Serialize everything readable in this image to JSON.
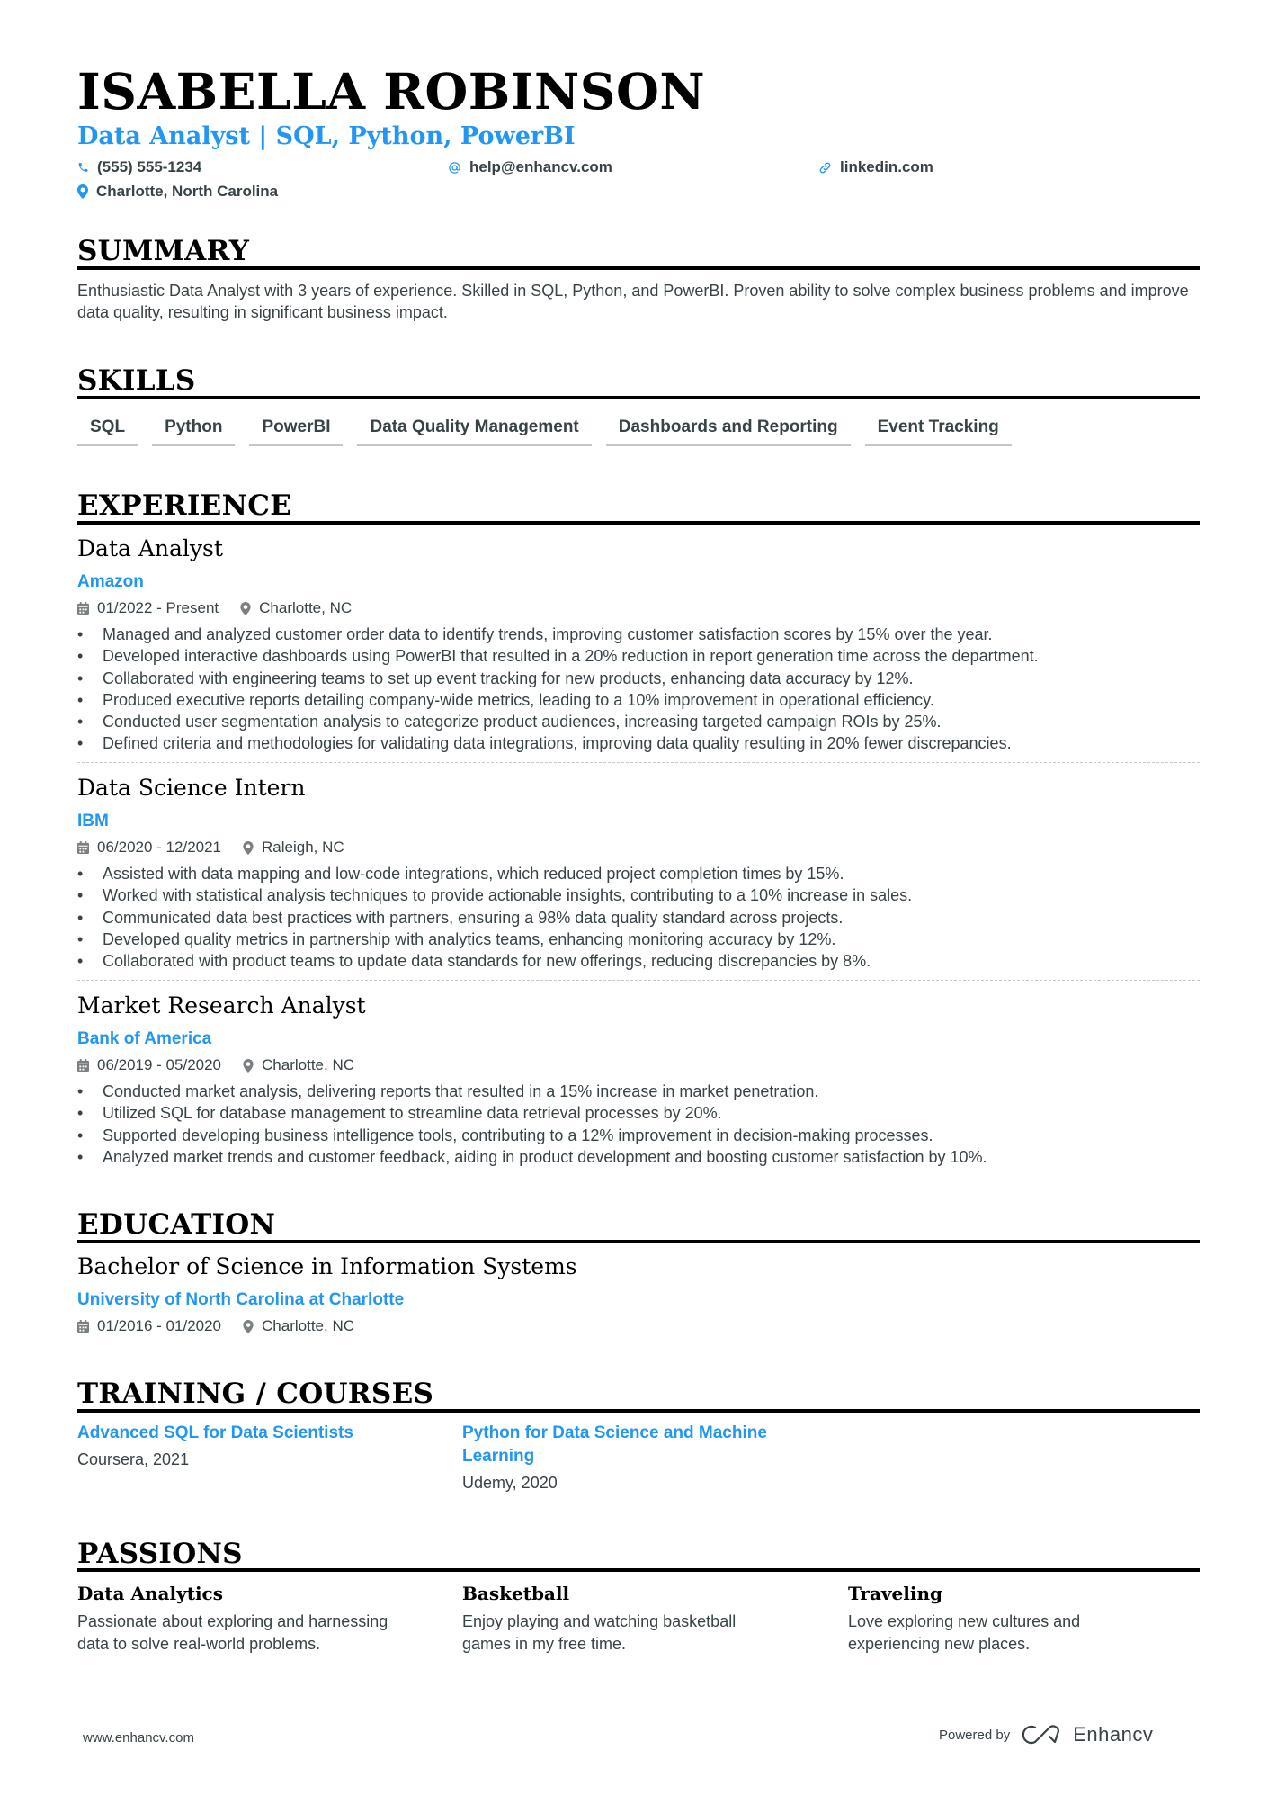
{
  "header": {
    "name": "ISABELLA ROBINSON",
    "subtitle": "Data Analyst | SQL, Python, PowerBI",
    "contacts": {
      "phone": {
        "icon": "phone-icon",
        "value": "(555) 555-1234"
      },
      "email": {
        "icon": "at-icon",
        "value": "help@enhancv.com"
      },
      "link": {
        "icon": "link-icon",
        "value": "linkedin.com"
      },
      "location": {
        "icon": "location-pin-icon",
        "value": "Charlotte, North Carolina"
      }
    }
  },
  "colors": {
    "accent": "#2196f3",
    "heading": "#000000",
    "text": "#384347",
    "skill_underline": "#c4c6c8"
  },
  "summary": {
    "title": "SUMMARY",
    "text": "Enthusiastic Data Analyst with 3 years of experience. Skilled in SQL, Python, and PowerBI. Proven ability to solve complex business problems and improve data quality, resulting in significant business impact."
  },
  "skills": {
    "title": "SKILLS",
    "items": [
      "SQL",
      "Python",
      "PowerBI",
      "Data Quality Management",
      "Dashboards and Reporting",
      "Event Tracking"
    ]
  },
  "experience": {
    "title": "EXPERIENCE",
    "jobs": [
      {
        "title": "Data Analyst",
        "company": "Amazon",
        "dates": "01/2022 - Present",
        "location": "Charlotte, NC",
        "bullets": [
          "Managed and analyzed customer order data to identify trends, improving customer satisfaction scores by 15% over the year.",
          "Developed interactive dashboards using PowerBI that resulted in a 20% reduction in report generation time across the department.",
          "Collaborated with engineering teams to set up event tracking for new products, enhancing data accuracy by 12%.",
          "Produced executive reports detailing company-wide metrics, leading to a 10% improvement in operational efficiency.",
          "Conducted user segmentation analysis to categorize product audiences, increasing targeted campaign ROIs by 25%.",
          "Defined criteria and methodologies for validating data integrations, improving data quality resulting in 20% fewer discrepancies."
        ]
      },
      {
        "title": "Data Science Intern",
        "company": "IBM",
        "dates": "06/2020 - 12/2021",
        "location": "Raleigh, NC",
        "bullets": [
          "Assisted with data mapping and low-code integrations, which reduced project completion times by 15%.",
          "Worked with statistical analysis techniques to provide actionable insights, contributing to a 10% increase in sales.",
          "Communicated data best practices with partners, ensuring a 98% data quality standard across projects.",
          "Developed quality metrics in partnership with analytics teams, enhancing monitoring accuracy by 12%.",
          "Collaborated with product teams to update data standards for new offerings, reducing discrepancies by 8%."
        ]
      },
      {
        "title": "Market Research Analyst",
        "company": "Bank of America",
        "dates": "06/2019 - 05/2020",
        "location": "Charlotte, NC",
        "bullets": [
          "Conducted market analysis, delivering reports that resulted in a 15% increase in market penetration.",
          "Utilized SQL for database management to streamline data retrieval processes by 20%.",
          "Supported developing business intelligence tools, contributing to a 12% improvement in decision-making processes.",
          "Analyzed market trends and customer feedback, aiding in product development and boosting customer satisfaction by 10%."
        ]
      }
    ]
  },
  "education": {
    "title": "EDUCATION",
    "degree": "Bachelor of Science in Information Systems",
    "school": "University of North Carolina at Charlotte",
    "dates": "01/2016 - 01/2020",
    "location": "Charlotte, NC"
  },
  "training": {
    "title": "TRAINING / COURSES",
    "items": [
      {
        "title": "Advanced SQL for Data Scientists",
        "provider": "Coursera, 2021"
      },
      {
        "title": "Python for Data Science and Machine Learning",
        "provider": "Udemy, 2020"
      }
    ]
  },
  "passions": {
    "title": "PASSIONS",
    "items": [
      {
        "title": "Data Analytics",
        "description": "Passionate about exploring and harnessing data to solve real-world problems."
      },
      {
        "title": "Basketball",
        "description": "Enjoy playing and watching basketball games in my free time."
      },
      {
        "title": "Traveling",
        "description": "Love exploring new cultures and experiencing new places."
      }
    ]
  },
  "footer": {
    "website": "www.enhancv.com",
    "powered_by": "Powered by",
    "brand": "Enhancv",
    "brand_icon": "enhancv-logo-icon"
  }
}
